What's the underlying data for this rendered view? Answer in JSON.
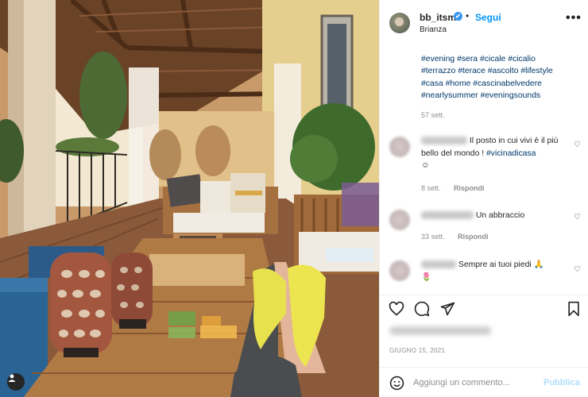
{
  "post": {
    "username": "bb_itsme",
    "verified_mark": "✔",
    "separator": "•",
    "follow_label": "Segui",
    "location": "Brianza",
    "more_icon": "more-horizontal-icon",
    "caption_hashtags": [
      "#evening",
      "#sera",
      "#cicale",
      "#cicalio",
      "#terrazzo",
      "#terace",
      "#ascolto",
      "#lifestyle",
      "#casa",
      "#home",
      "#cascinabelvedere",
      "#nearlysummer",
      "#eveningsounds"
    ],
    "caption_time": "57 sett.",
    "date": "GIUGNO 15, 2021",
    "colors": {
      "accent": "#0095f6",
      "link": "#00376b",
      "muted": "#8e8e8e",
      "publish_disabled": "#b2dffc"
    }
  },
  "comments": [
    {
      "text": "Il posto in cui vivi è il più bello del mondo !",
      "link": "#vicinadicasa",
      "extra": "☺",
      "time": "8 sett.",
      "reply_label": "Rispondi",
      "like_icon": "heart-outline-icon"
    },
    {
      "text": "Un abbraccio",
      "time": "33 sett.",
      "reply_label": "Rispondi",
      "like_icon": "heart-outline-icon"
    },
    {
      "text": "Sempre ai tuoi piedi 🙏",
      "extra": "🌷",
      "like_icon": "heart-outline-icon"
    }
  ],
  "actions": {
    "like_icon": "heart-outline-icon",
    "comment_icon": "comment-icon",
    "share_icon": "send-icon",
    "save_icon": "bookmark-icon"
  },
  "composer": {
    "emoji_icon": "smiley-icon",
    "placeholder": "Aggiungi un commento...",
    "publish_label": "Pubblica"
  },
  "photo": {
    "tag_icon": "user-tag-icon"
  }
}
